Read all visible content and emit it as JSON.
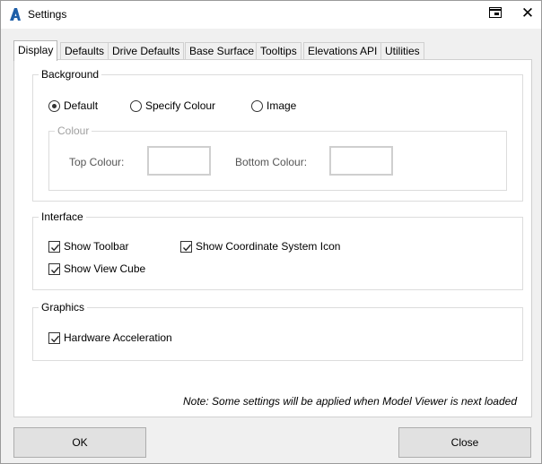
{
  "window": {
    "title": "Settings",
    "app_icon": "autodesk-a-icon",
    "controls": {
      "restore_icon": "restore-window-icon",
      "close_glyph": "✕"
    }
  },
  "tabs": [
    {
      "label": "Display",
      "active": true
    },
    {
      "label": "Defaults",
      "active": false
    },
    {
      "label": "Drive Defaults",
      "active": false
    },
    {
      "label": "Base Surface",
      "active": false
    },
    {
      "label": "Tooltips",
      "active": false
    },
    {
      "label": "Elevations API",
      "active": false
    },
    {
      "label": "Utilities",
      "active": false
    }
  ],
  "background": {
    "title": "Background",
    "options": [
      {
        "label": "Default",
        "selected": true
      },
      {
        "label": "Specify Colour",
        "selected": false
      },
      {
        "label": "Image",
        "selected": false
      }
    ],
    "colour": {
      "title": "Colour",
      "top_label": "Top Colour:",
      "bottom_label": "Bottom Colour:"
    }
  },
  "interface": {
    "title": "Interface",
    "show_toolbar": {
      "label": "Show Toolbar",
      "checked": true
    },
    "show_coordinate_icon": {
      "label": "Show Coordinate System Icon",
      "checked": true
    },
    "show_view_cube": {
      "label": "Show View Cube",
      "checked": true
    }
  },
  "graphics": {
    "title": "Graphics",
    "hardware_acceleration": {
      "label": "Hardware Acceleration",
      "checked": true
    }
  },
  "note": "Note: Some settings will be applied when Model Viewer is next loaded",
  "buttons": {
    "ok": "OK",
    "close": "Close"
  },
  "colors": {
    "accent": "#2b6cb0",
    "tab_active_bg": "#ffffff",
    "dialog_bg": "#f0f0f0"
  }
}
